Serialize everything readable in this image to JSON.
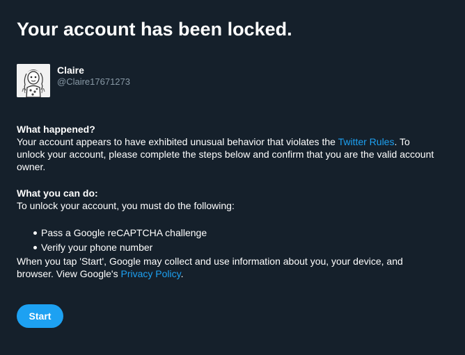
{
  "page": {
    "title": "Your account has been locked."
  },
  "user": {
    "display_name": "Claire",
    "handle": "@Claire17671273",
    "avatar_icon": "cartoon-avatar-icon"
  },
  "what_happened": {
    "heading": "What happened?",
    "text_before_link": "Your account appears to have exhibited unusual behavior that violates the ",
    "link_text": "Twitter Rules",
    "text_after_link": ". To unlock your account, please complete the steps below and confirm that you are the valid account owner."
  },
  "what_you_can_do": {
    "heading": "What you can do:",
    "intro": "To unlock your account, you must do the following:",
    "steps": [
      "Pass a Google reCAPTCHA challenge",
      "Verify your phone number"
    ],
    "notice_before_link": "When you tap 'Start', Google may collect and use information about you, your device, and browser. View Google's ",
    "privacy_link": "Privacy Policy",
    "notice_after_link": "."
  },
  "actions": {
    "start_label": "Start"
  },
  "colors": {
    "background": "#15202b",
    "accent": "#1da1f2",
    "secondary_text": "#8899a6"
  }
}
